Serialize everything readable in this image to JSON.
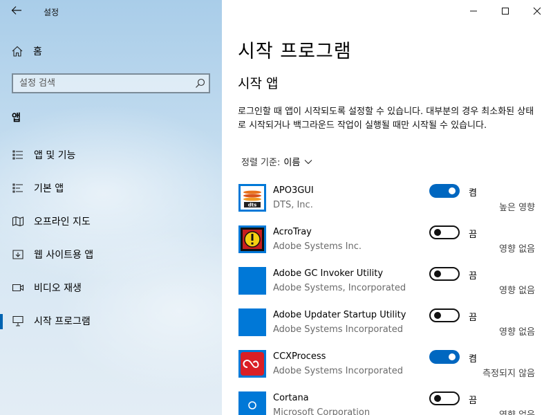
{
  "window": {
    "title": "설정",
    "controls": {
      "minimize": "minimize",
      "maximize": "maximize",
      "close": "close"
    }
  },
  "sidebar": {
    "home_label": "홈",
    "search_placeholder": "설정 검색",
    "section_label": "앱",
    "items": [
      {
        "label": "앱 및 기능",
        "icon": "apps-features-icon"
      },
      {
        "label": "기본 앱",
        "icon": "default-apps-icon"
      },
      {
        "label": "오프라인 지도",
        "icon": "offline-maps-icon"
      },
      {
        "label": "웹 사이트용 앱",
        "icon": "apps-for-websites-icon"
      },
      {
        "label": "비디오 재생",
        "icon": "video-playback-icon"
      },
      {
        "label": "시작 프로그램",
        "icon": "startup-icon",
        "active": true
      }
    ]
  },
  "main": {
    "title": "시작 프로그램",
    "subtitle": "시작 앱",
    "description": "로그인할 때 앱이 시작되도록 설정할 수 있습니다. 대부분의 경우 최소화된 상태로 시작되거나 백그라운드 작업이 실행될 때만 시작될 수 있습니다.",
    "sort_label": "정렬 기준:",
    "sort_value": "이름",
    "apps": [
      {
        "name": "APO3GUI",
        "publisher": "DTS, Inc.",
        "enabled": true,
        "state": "켬",
        "impact": "높은 영향",
        "icon": "dts-icon"
      },
      {
        "name": "AcroTray",
        "publisher": "Adobe Systems Inc.",
        "enabled": false,
        "state": "끔",
        "impact": "영향 없음",
        "icon": "acrotray-icon"
      },
      {
        "name": "Adobe GC Invoker Utility",
        "publisher": "Adobe Systems, Incorporated",
        "enabled": false,
        "state": "끔",
        "impact": "영향 없음",
        "icon": "blank-app-icon"
      },
      {
        "name": "Adobe Updater Startup Utility",
        "publisher": "Adobe Systems Incorporated",
        "enabled": false,
        "state": "끔",
        "impact": "영향 없음",
        "icon": "blank-app-icon"
      },
      {
        "name": "CCXProcess",
        "publisher": "Adobe Systems Incorporated",
        "enabled": true,
        "state": "켬",
        "impact": "측정되지 않음",
        "icon": "creative-cloud-icon"
      },
      {
        "name": "Cortana",
        "publisher": "Microsoft Corporation",
        "enabled": false,
        "state": "끔",
        "impact": "영향 없음",
        "icon": "cortana-icon"
      }
    ]
  },
  "colors": {
    "accent": "#0067c0",
    "tile_blue": "#0078d7",
    "active_indicator": "#0063b1"
  }
}
